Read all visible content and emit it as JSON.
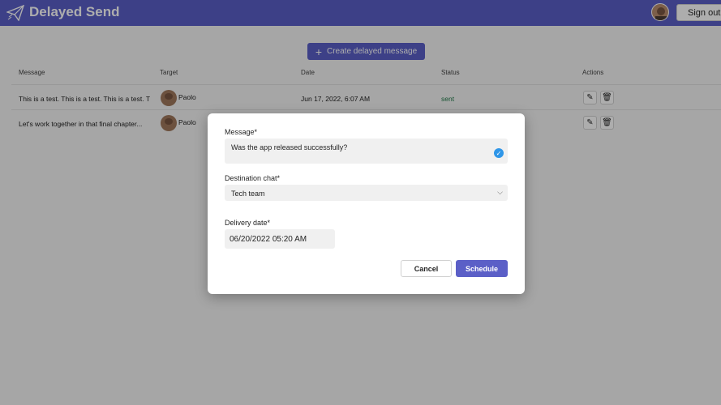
{
  "header": {
    "title": "Delayed Send",
    "sign_out_label": "Sign out",
    "accent_color": "#5b5fc7"
  },
  "toolbar": {
    "create_label": "Create delayed message",
    "create_icon": "plus-icon"
  },
  "table": {
    "columns": [
      "Message",
      "Target",
      "Date",
      "Status",
      "Actions"
    ],
    "rows": [
      {
        "message": "This is a test. This is a test. This is a test. T",
        "target": "Paolo",
        "date": "Jun 17, 2022, 6:07 AM",
        "status": "sent"
      },
      {
        "message": "Let's work together in that final chapter...",
        "target": "Paolo",
        "date": "",
        "status": ""
      }
    ],
    "action_icons": [
      "edit-icon",
      "delete-icon"
    ]
  },
  "dialog": {
    "message_label": "Message*",
    "message_value": "Was the app released successfully?",
    "destination_label": "Destination chat*",
    "destination_value": "Tech team",
    "delivery_label": "Delivery date*",
    "delivery_value": "06/20/2022 05:20 AM",
    "cancel_label": "Cancel",
    "schedule_label": "Schedule"
  }
}
